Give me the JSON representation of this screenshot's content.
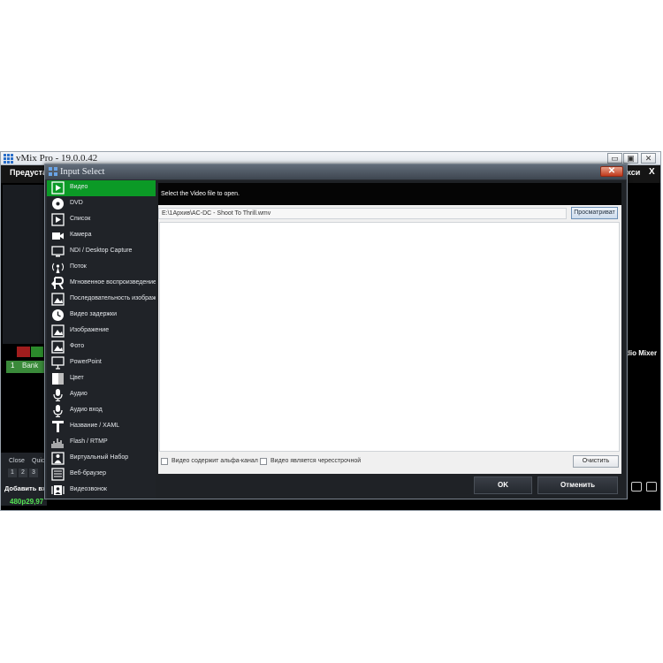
{
  "main_window": {
    "title": "vMix Pro - 19.0.0.42",
    "controls": {
      "minimize": "▭",
      "maximize": "▣",
      "close": "✕"
    },
    "menu": {
      "preview_label": "Предуста",
      "settings_label": "хси",
      "close_label": "X"
    },
    "bank": {
      "number": "1",
      "label": "Bank"
    },
    "lower_left": {
      "close_label": "Close",
      "quick_label": "Quic",
      "numbers": [
        "1",
        "2",
        "3"
      ],
      "add_input_label": "Добавить вхо",
      "resolution_label": "480p29,97"
    },
    "audio_mixer_label": "dio Mixer",
    "colors": {
      "bank_active": "#3a8a3a",
      "resolution_text": "#54e354"
    }
  },
  "dialog": {
    "title": "Input Select",
    "close_label": "✕",
    "input_types": [
      {
        "label": "Видео",
        "icon": "video-icon",
        "selected": true
      },
      {
        "label": "DVD",
        "icon": "dvd-icon",
        "selected": false
      },
      {
        "label": "Список",
        "icon": "list-icon",
        "selected": false
      },
      {
        "label": "Камера",
        "icon": "camera-icon",
        "selected": false
      },
      {
        "label": "NDI / Desktop Capture",
        "icon": "monitor-icon",
        "selected": false
      },
      {
        "label": "Поток",
        "icon": "stream-icon",
        "selected": false
      },
      {
        "label": "Мгновенное воспроизведение",
        "icon": "replay-icon",
        "selected": false
      },
      {
        "label": "Последовательность изображений",
        "icon": "image-sequence-icon",
        "selected": false
      },
      {
        "label": "Видео задержки",
        "icon": "video-delay-icon",
        "selected": false
      },
      {
        "label": "Изображение",
        "icon": "image-icon",
        "selected": false
      },
      {
        "label": "Фото",
        "icon": "photo-icon",
        "selected": false
      },
      {
        "label": "PowerPoint",
        "icon": "powerpoint-icon",
        "selected": false
      },
      {
        "label": "Цвет",
        "icon": "color-icon",
        "selected": false
      },
      {
        "label": "Аудио",
        "icon": "audio-icon",
        "selected": false
      },
      {
        "label": "Аудио вход",
        "icon": "audio-input-icon",
        "selected": false
      },
      {
        "label": "Название / XAML",
        "icon": "title-icon",
        "selected": false
      },
      {
        "label": "Flash / RTMP",
        "icon": "flash-icon",
        "selected": false
      },
      {
        "label": "Виртуальный Набор",
        "icon": "virtual-set-icon",
        "selected": false
      },
      {
        "label": "Веб-браузер",
        "icon": "web-browser-icon",
        "selected": false
      },
      {
        "label": "Видеозвонок",
        "icon": "video-call-icon",
        "selected": false
      }
    ],
    "prompt": "Select the Video file to open.",
    "file_path": "E:\\1Архив\\AC-DC - Shoot To Thrill.wmv",
    "browse_label": "Просматриват",
    "options": {
      "alpha_channel_label": "Видео содержит альфа-канал",
      "alpha_channel_checked": false,
      "interlaced_label": "Видео является чересстрочной",
      "interlaced_checked": false
    },
    "clear_label": "Очистить",
    "ok_label": "OK",
    "cancel_label": "Отменить",
    "colors": {
      "selected_item": "#0b9a26",
      "close_button": "#c0391b"
    }
  }
}
